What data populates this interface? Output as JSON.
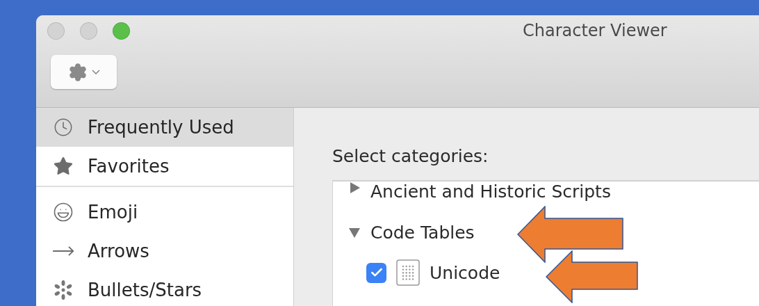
{
  "window": {
    "title": "Character Viewer"
  },
  "sidebar": {
    "items": [
      {
        "label": "Frequently Used",
        "selected": true
      },
      {
        "label": "Favorites",
        "selected": false
      },
      {
        "label": "Emoji",
        "selected": false
      },
      {
        "label": "Arrows",
        "selected": false
      },
      {
        "label": "Bullets/Stars",
        "selected": false
      }
    ]
  },
  "content": {
    "heading": "Select categories:",
    "categories": [
      {
        "label": "Ancient and Historic Scripts",
        "expanded": false
      },
      {
        "label": "Code Tables",
        "expanded": true,
        "children": [
          {
            "label": "Unicode",
            "checked": true
          }
        ]
      }
    ]
  }
}
